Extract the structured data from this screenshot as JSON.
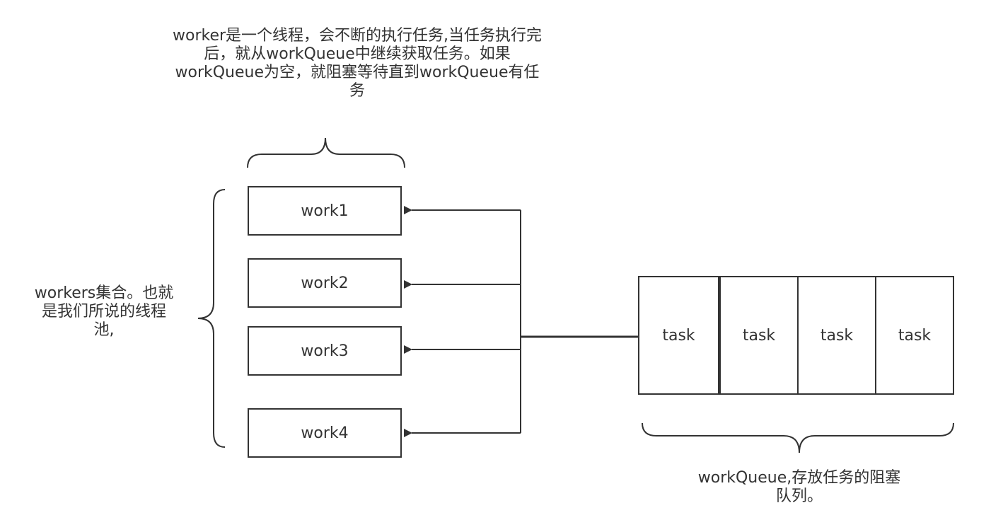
{
  "notes": {
    "worker_desc": [
      "worker是一个线程，会不断的执行任务,当任务执行完",
      "后，就从workQueue中继续获取任务。如果",
      "workQueue为空，就阻塞等待直到workQueue有任",
      "务"
    ],
    "workers_set": [
      "workers集合。也就",
      "是我们所说的线程",
      "池,"
    ],
    "queue_desc": [
      "workQueue,存放任务的阻塞",
      "队列。"
    ]
  },
  "workers": [
    "work1",
    "work2",
    "work3",
    "work4"
  ],
  "tasks": [
    "task",
    "task",
    "task",
    "task"
  ],
  "colors": {
    "stroke": "#333333",
    "text": "#333333",
    "background": "#ffffff"
  }
}
